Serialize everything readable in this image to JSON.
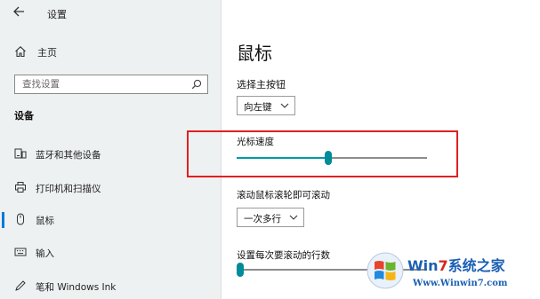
{
  "window": {
    "title": "设置"
  },
  "sidebar": {
    "home_label": "主页",
    "search_placeholder": "查找设置",
    "section_title": "设备",
    "items": [
      {
        "label": "蓝牙和其他设备",
        "icon": "bluetooth-devices-icon"
      },
      {
        "label": "打印机和扫描仪",
        "icon": "printer-icon"
      },
      {
        "label": "鼠标",
        "icon": "mouse-icon",
        "active": true
      },
      {
        "label": "输入",
        "icon": "keyboard-icon"
      },
      {
        "label": "笔和 Windows Ink",
        "icon": "pen-icon"
      }
    ]
  },
  "main": {
    "title": "鼠标",
    "primary_button": {
      "label": "选择主按钮",
      "value": "向左键"
    },
    "cursor_speed": {
      "label": "光标速度",
      "value_fraction": 0.48
    },
    "wheel_scroll": {
      "label": "滚动鼠标滚轮即可滚动",
      "value": "一次多行"
    },
    "lines_per_scroll": {
      "label": "设置每次要滚动的行数",
      "value_fraction": 0.02
    }
  },
  "watermark": {
    "brand_prefix": "Win",
    "brand_seven": "7",
    "brand_suffix": "系统之家",
    "url": "Www.Winwin7.com"
  },
  "colors": {
    "accent": "#0078d7",
    "slider": "#008b9a",
    "highlight": "#e02020"
  }
}
